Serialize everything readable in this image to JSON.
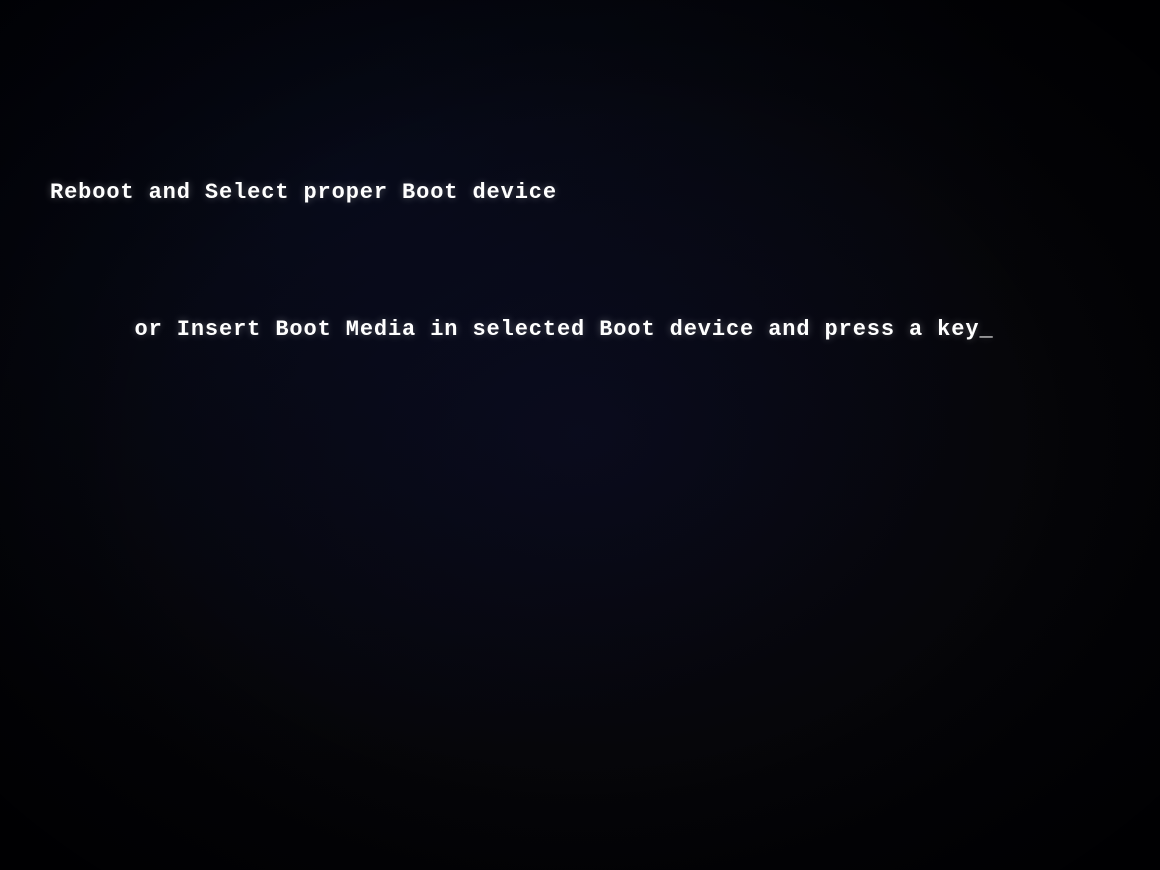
{
  "screen": {
    "background_color": "#050508",
    "boot_message": {
      "line1": "Reboot and Select proper Boot device",
      "line2": "or Insert Boot Media in selected Boot device and press a key",
      "cursor": "_"
    }
  }
}
